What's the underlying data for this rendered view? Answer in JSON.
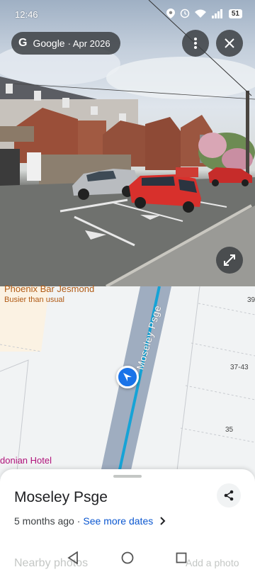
{
  "status_bar": {
    "time": "12:46",
    "battery": "51"
  },
  "source": {
    "provider": "Google",
    "date": "· Apr 2026"
  },
  "map": {
    "poi_name": "Phoenix Bar Jesmond",
    "poi_status": "Busier than usual",
    "street": "Moseley Psge",
    "numbers": [
      "39",
      "37-43",
      "35"
    ],
    "hotel": "donian Hotel"
  },
  "sheet": {
    "title": "Moseley Psge",
    "age": "5 months ago ·",
    "more_dates": "See more dates",
    "nearby": "Nearby photos",
    "add_photo": "Add a photo"
  },
  "colors": {
    "accent": "#1a73e8",
    "link": "#0b57d0",
    "road": "#9fadc0",
    "poi": "#b05a14",
    "hotel": "#b0127a"
  },
  "icons": [
    "google-g-icon",
    "more-vert-icon",
    "close-icon",
    "fullscreen-icon",
    "share-icon",
    "direction-arrow-icon",
    "back-nav-icon",
    "home-nav-icon",
    "recents-nav-icon"
  ]
}
